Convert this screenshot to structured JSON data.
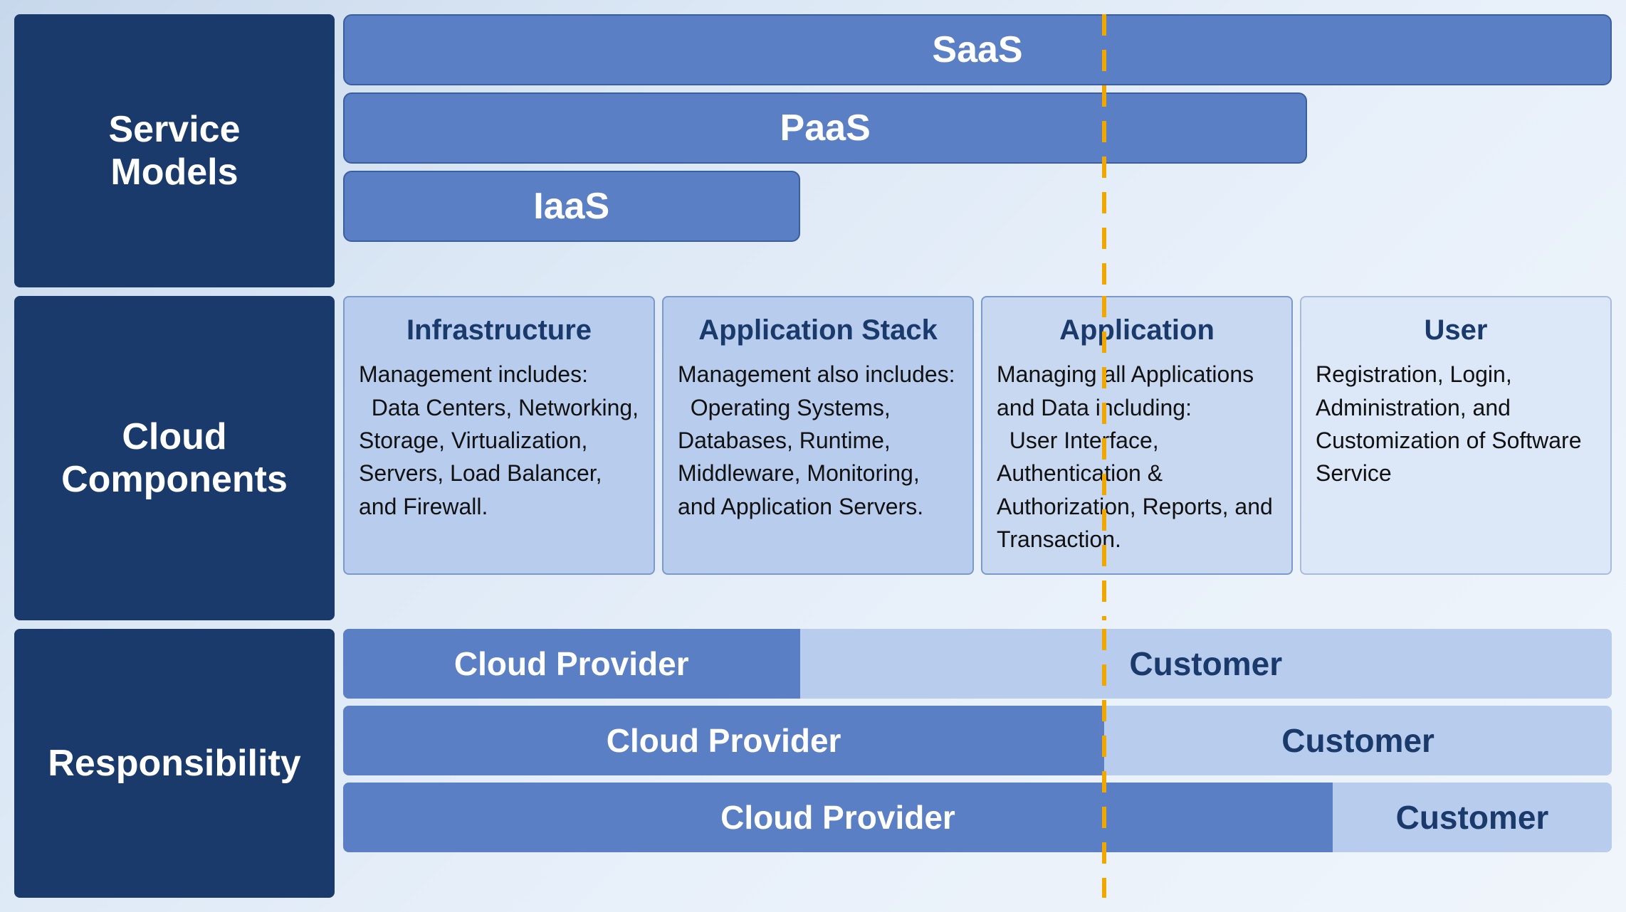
{
  "labels": {
    "service_models": "Service\nModels",
    "cloud_components": "Cloud\nComponents",
    "responsibility": "Responsibility"
  },
  "service_models": {
    "saas": "SaaS",
    "paas": "PaaS",
    "iaas": "IaaS"
  },
  "cloud_components": {
    "infrastructure": {
      "title": "Infrastructure",
      "body": "Management includes:\n  Data Centers, Networking, Storage, Virtualization, Servers, Load Balancer, and Firewall."
    },
    "app_stack": {
      "title": "Application Stack",
      "body": "Management also includes:\n  Operating Systems, Databases, Runtime, Middleware, Monitoring, and Application Servers."
    },
    "application": {
      "title": "Application",
      "body": "Managing all Applications and Data including:\n  User Interface, Authentication & Authorization, Reports, and Transaction."
    },
    "user": {
      "title": "User",
      "body": "Registration, Login, Administration, and Customization of Software Service"
    }
  },
  "responsibility": {
    "rows": [
      {
        "provider": "Cloud Provider",
        "customer": "Customer",
        "provider_pct": 36,
        "customer_pct": 64
      },
      {
        "provider": "Cloud Provider",
        "customer": "Customer",
        "provider_pct": 60,
        "customer_pct": 40
      },
      {
        "provider": "Cloud Provider",
        "customer": "Customer",
        "provider_pct": 78,
        "customer_pct": 22
      }
    ]
  },
  "dashed_line_color": "#f0a800"
}
